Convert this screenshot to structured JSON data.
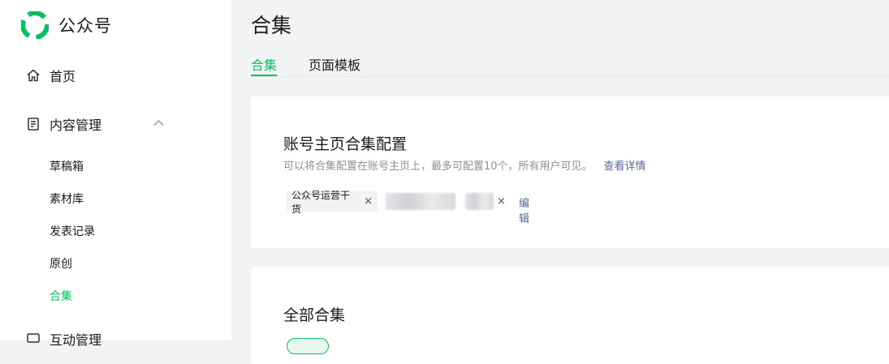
{
  "brand": {
    "name": "公众号",
    "accent": "#07c160"
  },
  "sidebar": {
    "home": {
      "label": "首页",
      "icon": "home-icon"
    },
    "content": {
      "label": "内容管理",
      "icon": "document-icon",
      "expanded": true
    },
    "sub_items": [
      {
        "label": "草稿箱",
        "active": false
      },
      {
        "label": "素材库",
        "active": false
      },
      {
        "label": "发表记录",
        "active": false
      },
      {
        "label": "原创",
        "active": false
      },
      {
        "label": "合集",
        "active": true
      }
    ],
    "interact": {
      "label": "互动管理",
      "icon": "chat-icon"
    }
  },
  "main": {
    "title": "合集",
    "tabs": [
      {
        "label": "合集",
        "active": true
      },
      {
        "label": "页面模板",
        "active": false
      }
    ],
    "homepage_card": {
      "title": "账号主页合集配置",
      "description": "可以将合集配置在账号主页上，最多可配置10个，所有用户可见。",
      "details_link": "查看详情",
      "tags": [
        {
          "label": "公众号运营干货",
          "removable": true
        },
        {
          "label": "",
          "blurred": true,
          "removable": false
        },
        {
          "label": "",
          "blurred": true,
          "removable": true
        }
      ],
      "remove_symbol": "×",
      "edit_label": "编辑"
    },
    "all_card": {
      "title": "全部合集"
    }
  }
}
